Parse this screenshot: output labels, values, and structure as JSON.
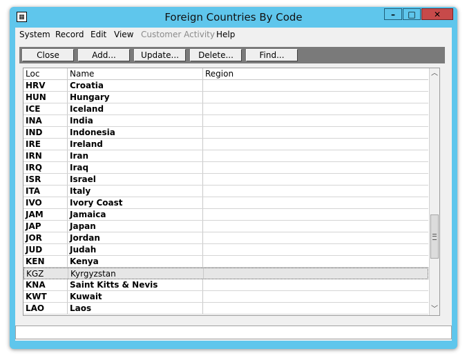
{
  "window": {
    "title": "Foreign Countries By Code",
    "app_icon_glyph": "▦",
    "min_glyph": "–",
    "max_glyph": "□",
    "close_glyph": "✕"
  },
  "menu": [
    "System",
    "Record",
    "Edit",
    "View",
    "Customer Activity",
    "Help"
  ],
  "toolbar": {
    "close_label": "Close",
    "add_label": "Add...",
    "update_label": "Update...",
    "delete_label": "Delete...",
    "find_label": "Find..."
  },
  "table": {
    "headers": {
      "loc": "Loc",
      "name": "Name",
      "region": "Region"
    },
    "rows": [
      {
        "loc": "HRV",
        "name": "Croatia",
        "region": ""
      },
      {
        "loc": "HUN",
        "name": "Hungary",
        "region": ""
      },
      {
        "loc": "ICE",
        "name": "Iceland",
        "region": ""
      },
      {
        "loc": "INA",
        "name": "India",
        "region": ""
      },
      {
        "loc": "IND",
        "name": "Indonesia",
        "region": ""
      },
      {
        "loc": "IRE",
        "name": "Ireland",
        "region": ""
      },
      {
        "loc": "IRN",
        "name": "Iran",
        "region": ""
      },
      {
        "loc": "IRQ",
        "name": "Iraq",
        "region": ""
      },
      {
        "loc": "ISR",
        "name": "Israel",
        "region": ""
      },
      {
        "loc": "ITA",
        "name": "Italy",
        "region": ""
      },
      {
        "loc": "IVO",
        "name": "Ivory Coast",
        "region": ""
      },
      {
        "loc": "JAM",
        "name": "Jamaica",
        "region": ""
      },
      {
        "loc": "JAP",
        "name": "Japan",
        "region": ""
      },
      {
        "loc": "JOR",
        "name": "Jordan",
        "region": ""
      },
      {
        "loc": "JUD",
        "name": "Judah",
        "region": ""
      },
      {
        "loc": "KEN",
        "name": "Kenya",
        "region": ""
      },
      {
        "loc": "KGZ",
        "name": "Kyrgyzstan",
        "region": "",
        "selected": true
      },
      {
        "loc": "KNA",
        "name": "Saint Kitts & Nevis",
        "region": ""
      },
      {
        "loc": "KWT",
        "name": "Kuwait",
        "region": ""
      },
      {
        "loc": "LAO",
        "name": "Laos",
        "region": ""
      }
    ]
  },
  "scrollbar": {
    "up_glyph": "︿",
    "down_glyph": "﹀"
  },
  "colors": {
    "titlebar": "#5fc6ec",
    "close_button": "#c74a4a",
    "toolbar": "#7a7a7a",
    "selected_row": "#e6e6e6"
  }
}
